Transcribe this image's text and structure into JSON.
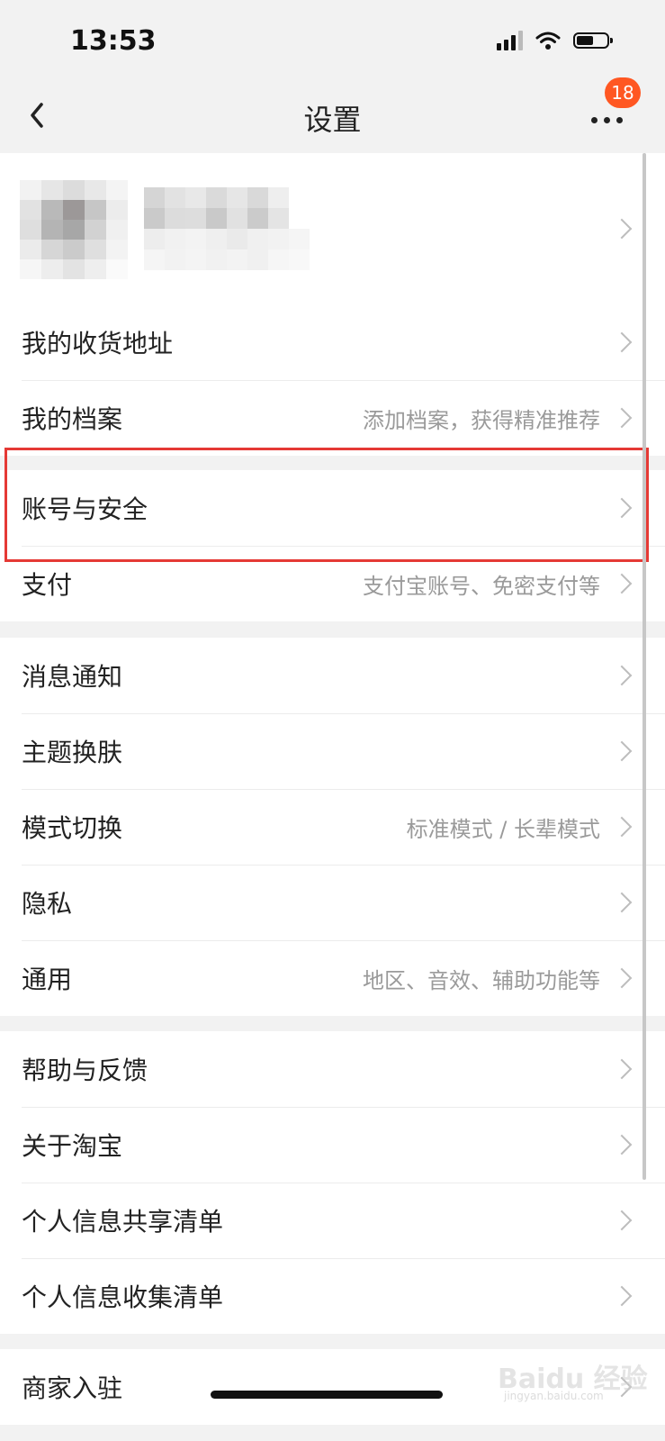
{
  "status_bar": {
    "time": "13:53"
  },
  "nav": {
    "title": "设置",
    "badge": "18"
  },
  "rows": {
    "address": {
      "label": "我的收货地址"
    },
    "profile_archive": {
      "label": "我的档案",
      "hint": "添加档案，获得精准推荐"
    },
    "account_security": {
      "label": "账号与安全"
    },
    "payment": {
      "label": "支付",
      "hint": "支付宝账号、免密支付等"
    },
    "notifications": {
      "label": "消息通知"
    },
    "theme": {
      "label": "主题换肤"
    },
    "mode": {
      "label": "模式切换",
      "hint": "标准模式 / 长辈模式"
    },
    "privacy": {
      "label": "隐私"
    },
    "general": {
      "label": "通用",
      "hint": "地区、音效、辅助功能等"
    },
    "help": {
      "label": "帮助与反馈"
    },
    "about": {
      "label": "关于淘宝"
    },
    "info_share": {
      "label": "个人信息共享清单"
    },
    "info_collect": {
      "label": "个人信息收集清单"
    },
    "merchant": {
      "label": "商家入驻"
    }
  },
  "watermark": {
    "text": "Baidu 经验",
    "sub": "jingyan.baidu.com"
  },
  "colors": {
    "badge": "#ff5722",
    "highlight": "#e53935",
    "background": "#f2f2f2"
  }
}
